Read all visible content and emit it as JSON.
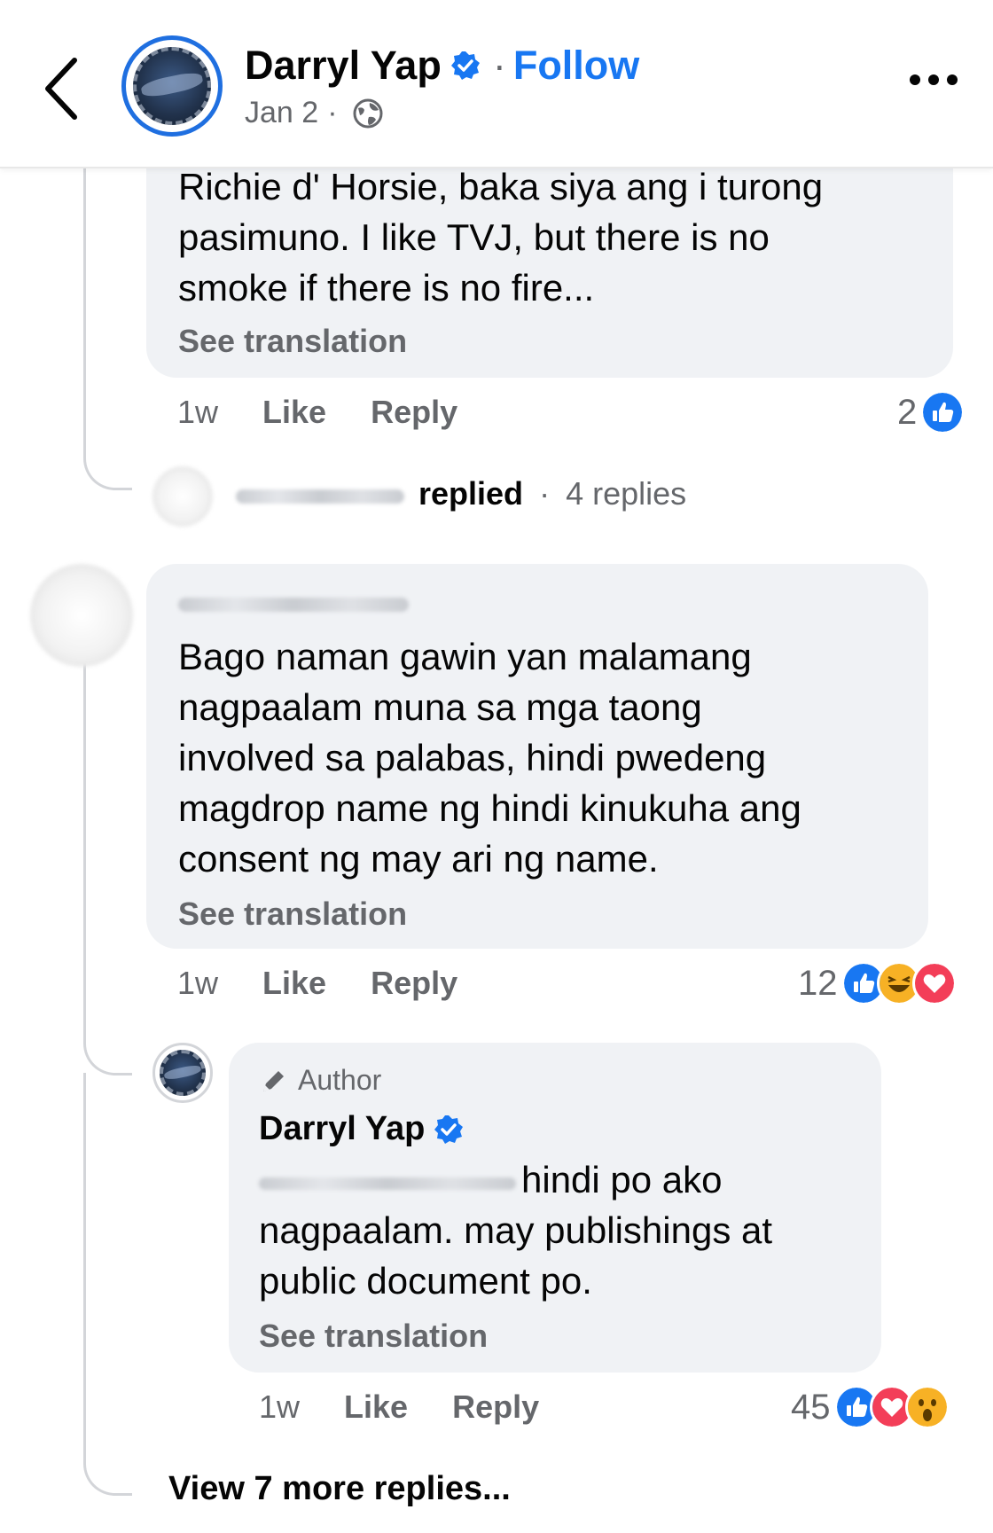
{
  "header": {
    "author_name": "Darryl Yap",
    "separator": "·",
    "follow_label": "Follow",
    "date": "Jan 2",
    "date_separator": "·"
  },
  "comment1": {
    "text_lines": [
      "Richie d' Horsie, baka siya ang i turong",
      "pasimuno.  I like TVJ, but there is no",
      "smoke if there is no fire..."
    ],
    "see_translation": "See translation",
    "time": "1w",
    "like_label": "Like",
    "reply_label": "Reply",
    "reaction_count": "2",
    "replied_summary": {
      "replied_label": "replied",
      "separator": "·",
      "replies_count": "4 replies"
    }
  },
  "comment2": {
    "text_lines": [
      "Bago naman gawin yan malamang",
      "nagpaalam muna sa mga taong",
      "involved sa palabas, hindi pwedeng",
      "magdrop name ng hindi kinukuha ang",
      "consent ng may ari ng name."
    ],
    "see_translation": "See translation",
    "time": "1w",
    "like_label": "Like",
    "reply_label": "Reply",
    "reaction_count": "12"
  },
  "reply": {
    "author_badge": "Author",
    "name": "Darryl Yap",
    "text_first": "hindi po ako",
    "text_lines": [
      "nagpaalam. may publishings at",
      "public document po."
    ],
    "see_translation": "See translation",
    "time": "1w",
    "like_label": "Like",
    "reply_label": "Reply",
    "reaction_count": "45"
  },
  "view_more": "View 7 more replies...",
  "colors": {
    "accent": "#1877f2",
    "bubble": "#f0f2f5",
    "secondary_text": "#65676b",
    "love": "#f33e58",
    "haha": "#f7b125"
  }
}
